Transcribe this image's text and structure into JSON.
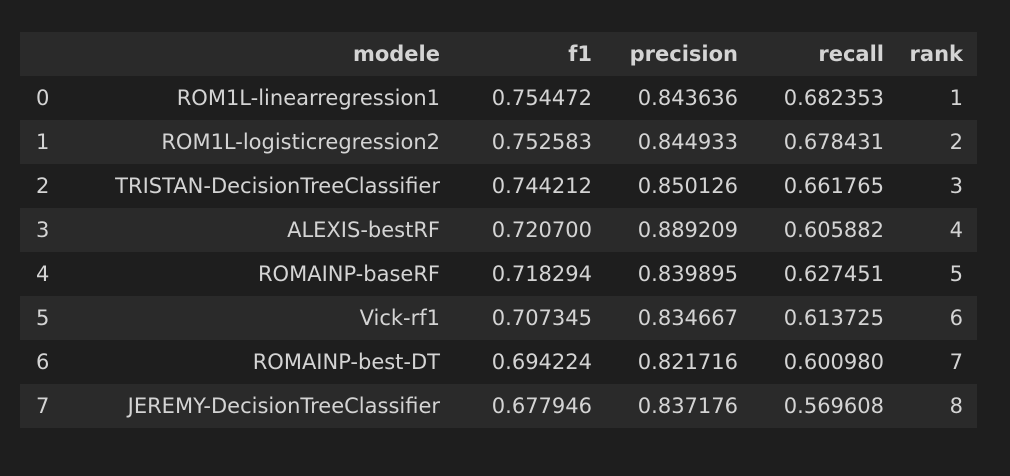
{
  "table": {
    "columns": [
      "modele",
      "f1",
      "precision",
      "recall",
      "rank"
    ],
    "rows": [
      {
        "index": "0",
        "modele": "ROM1L-linearregression1",
        "f1": "0.754472",
        "precision": "0.843636",
        "recall": "0.682353",
        "rank": "1"
      },
      {
        "index": "1",
        "modele": "ROM1L-logisticregression2",
        "f1": "0.752583",
        "precision": "0.844933",
        "recall": "0.678431",
        "rank": "2"
      },
      {
        "index": "2",
        "modele": "TRISTAN-DecisionTreeClassifier",
        "f1": "0.744212",
        "precision": "0.850126",
        "recall": "0.661765",
        "rank": "3"
      },
      {
        "index": "3",
        "modele": "ALEXIS-bestRF",
        "f1": "0.720700",
        "precision": "0.889209",
        "recall": "0.605882",
        "rank": "4"
      },
      {
        "index": "4",
        "modele": "ROMAINP-baseRF",
        "f1": "0.718294",
        "precision": "0.839895",
        "recall": "0.627451",
        "rank": "5"
      },
      {
        "index": "5",
        "modele": "Vick-rf1",
        "f1": "0.707345",
        "precision": "0.834667",
        "recall": "0.613725",
        "rank": "6"
      },
      {
        "index": "6",
        "modele": "ROMAINP-best-DT",
        "f1": "0.694224",
        "precision": "0.821716",
        "recall": "0.600980",
        "rank": "7"
      },
      {
        "index": "7",
        "modele": "JEREMY-DecisionTreeClassifier",
        "f1": "0.677946",
        "precision": "0.837176",
        "recall": "0.569608",
        "rank": "8"
      }
    ]
  }
}
